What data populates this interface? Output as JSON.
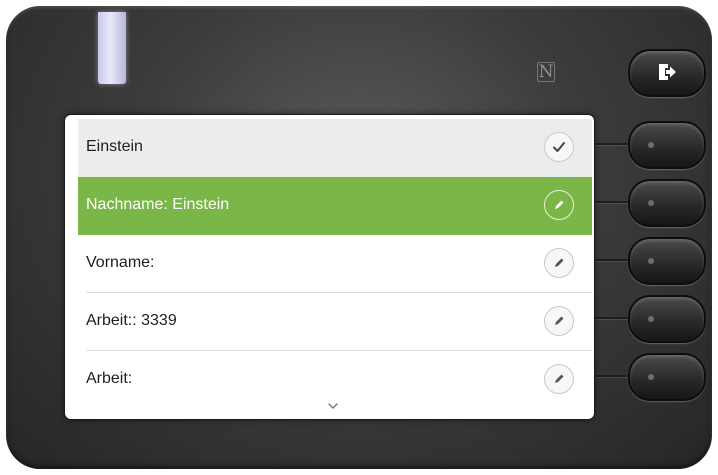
{
  "menu": {
    "rows": [
      {
        "label": "Einstein",
        "icon": "check-icon",
        "state": "header"
      },
      {
        "label": "Nachname: Einstein",
        "icon": "pencil-icon",
        "state": "selected"
      },
      {
        "label": "Vorname:",
        "icon": "pencil-icon",
        "state": "normal"
      },
      {
        "label": "Arbeit:: 3339",
        "icon": "pencil-icon",
        "state": "normal"
      },
      {
        "label": "Arbeit:",
        "icon": "pencil-icon",
        "state": "normal"
      }
    ],
    "more_indicator": "chevron-down-icon"
  },
  "device": {
    "nfc_mark": "N",
    "exit_key_icon": "exit-arrow-icon"
  },
  "colors": {
    "selection": "#7ab648",
    "header_row": "#ececec",
    "bezel": "#3c3c3c",
    "led": "#d9d9f0"
  }
}
